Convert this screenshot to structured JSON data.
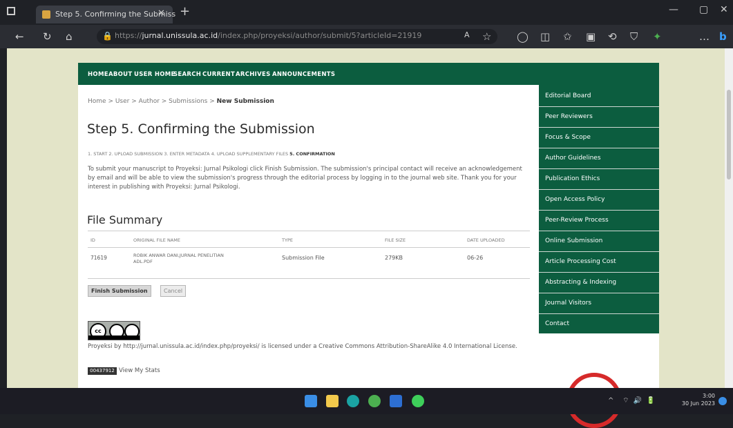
{
  "browser": {
    "tab_title": "Step 5. Confirming the Submiss",
    "url_host": "jurnal.unissula.ac.id",
    "url_prefix": "https://",
    "url_path": "/index.php/proyeksi/author/submit/5?articleId=21919"
  },
  "nav": [
    "HOME",
    "ABOUT",
    "USER HOME",
    "SEARCH",
    "CURRENT",
    "ARCHIVES",
    "ANNOUNCEMENTS"
  ],
  "breadcrumb": {
    "trail": "Home > User > Author > Submissions > ",
    "current": "New Submission"
  },
  "title": "Step 5. Confirming the Submission",
  "steps": {
    "trail": "1. START  2. UPLOAD SUBMISSION  3. ENTER METADATA  4. UPLOAD SUPPLEMENTARY FILES  ",
    "current": "5. CONFIRMATION"
  },
  "intro": "To submit your manuscript to Proyeksi: Jurnal Psikologi click Finish Submission. The submission's principal contact will receive an acknowledgement by email and will be able to view the submission's progress through the editorial process by logging in to the journal web site. Thank you for your interest in publishing with Proyeksi: Jurnal Psikologi.",
  "file_summary": {
    "title": "File Summary",
    "headers": [
      "ID",
      "ORIGINAL FILE NAME",
      "TYPE",
      "FILE SIZE",
      "DATE UPLOADED"
    ],
    "rows": [
      {
        "id": "71619",
        "name": "ROBIK ANWAR DANI,JURNAL PENELITIAN ADL.PDF",
        "type": "Submission File",
        "size": "279KB",
        "date": "06-26"
      }
    ]
  },
  "buttons": {
    "finish": "Finish Submission",
    "cancel": "Cancel"
  },
  "license": "Proyeksi by http://jurnal.unissula.ac.id/index.php/proyeksi/ is licensed under a Creative Commons Attribution-ShareAlike 4.0 International License.",
  "counter": "00437912",
  "view_my": "View My Stats",
  "sidebar": [
    "Editorial Board",
    "Peer Reviewers",
    "Focus & Scope",
    "Author Guidelines",
    "Publication Ethics",
    "Open Access Policy",
    "Peer-Review Process",
    "Online Submission",
    "Article Processing Cost",
    "Abstracting & Indexing",
    "Journal Visitors",
    "Contact"
  ],
  "clock": {
    "time": "3:00",
    "date": "30 Jun 2023"
  },
  "colors": {
    "nav_green": "#0c5d3f",
    "page_bg": "#e3e4c8"
  }
}
